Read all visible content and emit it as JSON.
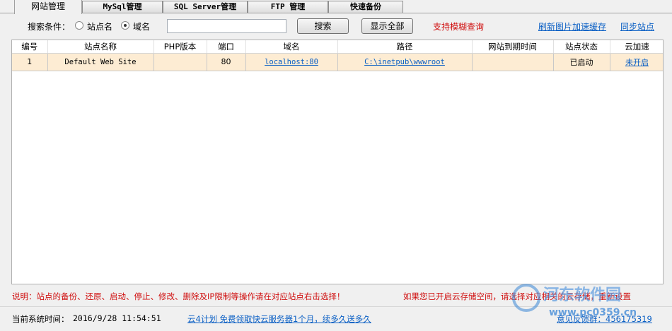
{
  "tabs": [
    {
      "label": "网站管理",
      "active": true
    },
    {
      "label": "MySql管理",
      "active": false
    },
    {
      "label": "SQL Server管理",
      "active": false
    },
    {
      "label": "FTP 管理",
      "active": false
    },
    {
      "label": "快速备份",
      "active": false
    }
  ],
  "search": {
    "label": "搜索条件：",
    "option_site": "站点名",
    "option_domain": "域名",
    "selected": "域名",
    "value": "",
    "search_button": "搜索",
    "show_all_button": "显示全部",
    "fuzzy_note": "支持模糊查询",
    "refresh_cache_link": "刷新图片加速缓存",
    "sync_link": "同步站点"
  },
  "table": {
    "columns": [
      "编号",
      "站点名称",
      "PHP版本",
      "端口",
      "域名",
      "路径",
      "网站到期时间",
      "站点状态",
      "云加速"
    ],
    "rows": [
      {
        "id": "1",
        "name": "Default Web Site",
        "php": "",
        "port": "80",
        "domain": "localhost:80",
        "path": "C:\\inetpub\\wwwroot",
        "expire": "",
        "status": "已启动",
        "cloud": "未开启"
      }
    ]
  },
  "notice": {
    "left": "说明：站点的备份、还原、启动、停止、修改、删除及IP限制等操作请在对应站点右击选择！",
    "right": "如果您已开启云存储空间，请选择对应相关的云存储，重新设置"
  },
  "status_bar": {
    "time_label": "当前系统时间：",
    "time_value": "2016/9/28 11:54:51",
    "promo_link": "云4计划  免费领取快云服务器1个月，续多久送多久",
    "feedback": "意见反馈群：456175319"
  },
  "watermark": {
    "title": "河东软件园",
    "url": "www.pc0359.cn"
  },
  "colors": {
    "row_bg": "#fdecd3",
    "link": "#0a5fc4",
    "alert": "#d01010"
  }
}
